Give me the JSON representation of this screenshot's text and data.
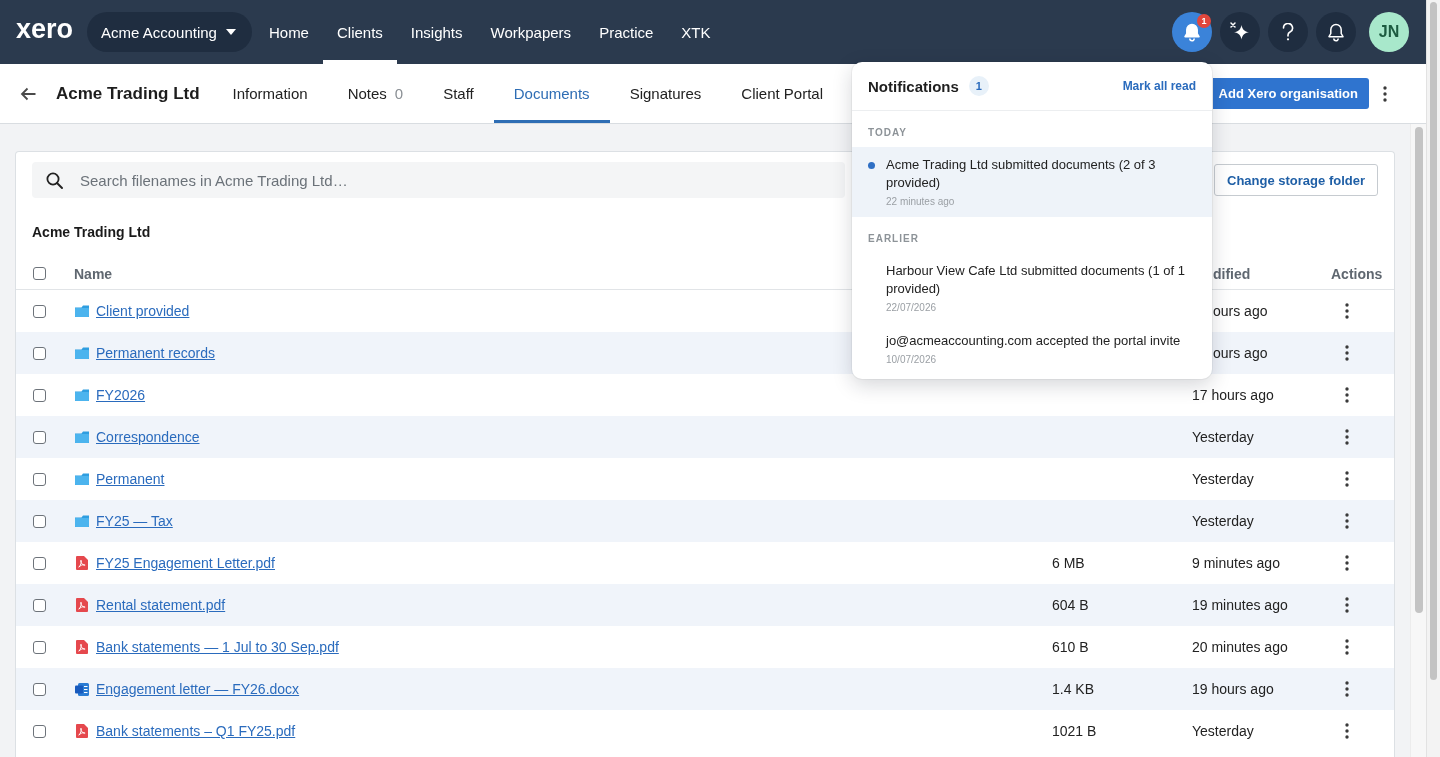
{
  "top_nav": {
    "logo": "xero",
    "organisation": "Acme Accounting",
    "items": [
      {
        "label": "Home",
        "selected": false
      },
      {
        "label": "Clients",
        "selected": true
      },
      {
        "label": "Insights",
        "selected": false
      },
      {
        "label": "Workpapers",
        "selected": false
      },
      {
        "label": "Practice",
        "selected": false
      },
      {
        "label": "XTK",
        "selected": false
      }
    ],
    "actions": [
      {
        "kind": "bell",
        "badge": "1",
        "active": true
      },
      {
        "kind": "sparkle",
        "active": false
      },
      {
        "kind": "help",
        "active": false
      },
      {
        "kind": "bell",
        "active": false
      }
    ],
    "avatar": "JN"
  },
  "client_header": {
    "title": "Acme Trading Ltd",
    "tabs": [
      {
        "label": "Information",
        "selected": false
      },
      {
        "label": "Notes",
        "count": "0",
        "selected": false
      },
      {
        "label": "Staff",
        "selected": false
      },
      {
        "label": "Documents",
        "selected": true
      },
      {
        "label": "Signatures",
        "selected": false
      },
      {
        "label": "Client Portal",
        "selected": false
      }
    ],
    "primary_button": "Add Xero organisation"
  },
  "documents": {
    "search": {
      "placeholder": "Search filenames in Acme Trading Ltd…"
    },
    "change_folder_button": "Change storage folder",
    "folder_title": "Acme Trading Ltd",
    "table": {
      "select_all": {
        "checked": false
      },
      "columns": {
        "name": "Name",
        "column_4": "dified",
        "actions": "Actions"
      },
      "rows": [
        {
          "name": "Client provided",
          "kind": "folder",
          "modified": "ours ago",
          "checked": false
        },
        {
          "name": "Permanent records",
          "kind": "folder",
          "modified": "ours ago",
          "checked": false
        },
        {
          "name": "FY2026",
          "kind": "folder",
          "modified": "17 hours ago",
          "checked": false
        },
        {
          "name": "Correspondence",
          "kind": "folder",
          "modified": "Yesterday",
          "checked": false
        },
        {
          "name": "Permanent",
          "kind": "folder",
          "modified": "Yesterday",
          "checked": false
        },
        {
          "name": "FY25 — Tax",
          "kind": "folder",
          "modified": "Yesterday",
          "checked": false
        },
        {
          "name": "FY25 Engagement Letter.pdf",
          "kind": "pdf",
          "size": "6 MB",
          "modified": "9 minutes ago",
          "checked": false
        },
        {
          "name": "Rental statement.pdf",
          "kind": "pdf",
          "size": "604 B",
          "modified": "19 minutes ago",
          "checked": false
        },
        {
          "name": "Bank statements — 1 Jul to 30 Sep.pdf",
          "kind": "pdf",
          "size": "610 B",
          "modified": "20 minutes ago",
          "checked": false
        },
        {
          "name": "Engagement letter — FY26.docx",
          "kind": "docx",
          "size": "1.4 KB",
          "modified": "19 hours ago",
          "checked": false
        },
        {
          "name": "Bank statements – Q1 FY25.pdf",
          "kind": "pdf",
          "size": "1021 B",
          "modified": "Yesterday",
          "checked": false
        }
      ]
    }
  },
  "notifications": {
    "title": "Notifications",
    "count": "1",
    "mark_all_read": "Mark all read",
    "sections": [
      {
        "label": "TODAY",
        "items": [
          {
            "text": "Acme Trading Ltd submitted documents (2 of 3 provided)",
            "time": "22 minutes ago",
            "unread": true
          }
        ]
      },
      {
        "label": "EARLIER",
        "items": [
          {
            "text": "Harbour View Cafe Ltd submitted documents (1 of 1 provided)",
            "time": "22/07/2026",
            "unread": false
          },
          {
            "text": "jo@acmeaccounting.com accepted the portal invite",
            "time": "10/07/2026",
            "unread": false
          }
        ]
      }
    ]
  }
}
